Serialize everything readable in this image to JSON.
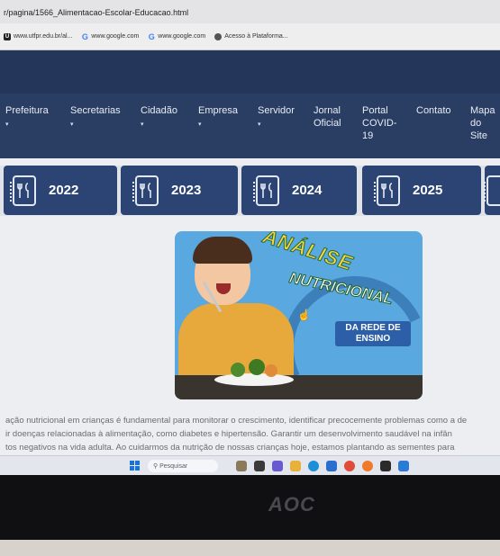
{
  "browser": {
    "url": "r/pagina/1566_Alimentacao-Escolar-Educacao.html",
    "bookmarks": [
      {
        "icon": "utf-icon",
        "label": "www.utfpr.edu.br/al..."
      },
      {
        "icon": "google-icon",
        "label": "www.google.com"
      },
      {
        "icon": "google-icon",
        "label": "www.google.com"
      },
      {
        "icon": "acesso-icon",
        "label": "Acesso à Plataforma..."
      }
    ]
  },
  "nav": {
    "items": [
      {
        "label": "Prefeitura",
        "caret": "▾"
      },
      {
        "label": "Secretarias",
        "caret": "▾"
      },
      {
        "label": "Cidadão",
        "caret": "▾"
      },
      {
        "label": "Empresa",
        "caret": "▾"
      },
      {
        "label": "Servidor",
        "caret": "▾"
      },
      {
        "label": "Jornal Oficial",
        "caret": ""
      },
      {
        "label": "Portal COVID-19",
        "caret": ""
      },
      {
        "label": "Contato",
        "caret": ""
      },
      {
        "label": "Mapa do Site",
        "caret": ""
      }
    ]
  },
  "years": [
    "2022",
    "2023",
    "2024",
    "2025"
  ],
  "banner": {
    "line1": "ANÁLISE",
    "line2": "NUTRICIONAL",
    "badge1": "DA REDE DE",
    "badge2": "ENSINO"
  },
  "paragraph": {
    "lines": [
      "ação nutricional em crianças é fundamental para monitorar o crescimento, identificar precocemente problemas como a de",
      "ir doenças relacionadas à alimentação, como diabetes e hipertensão. Garantir um desenvolvimento saudável na infân",
      "tos negativos na vida adulta. Ao cuidarmos da nutrição de nossas crianças hoje, estamos plantando as sementes para"
    ]
  },
  "taskbar": {
    "search_placeholder": "Pesquisar"
  },
  "monitor": {
    "brand": "AOC"
  }
}
